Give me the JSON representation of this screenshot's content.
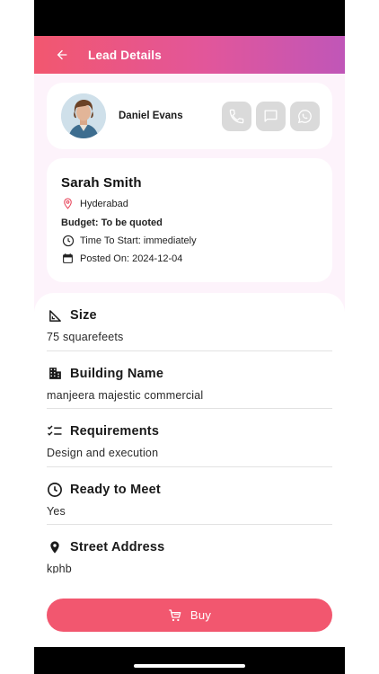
{
  "header": {
    "title": "Lead Details",
    "back_icon": "arrow-left-icon"
  },
  "contact": {
    "name": "Daniel Evans",
    "actions": [
      {
        "name": "call",
        "icon": "phone-icon"
      },
      {
        "name": "message",
        "icon": "chat-icon"
      },
      {
        "name": "whatsapp",
        "icon": "whatsapp-icon"
      }
    ]
  },
  "lead": {
    "name": "Sarah Smith",
    "location": "Hyderabad",
    "budget": "Budget: To be quoted",
    "time_to_start": "Time To Start: immediately",
    "posted_on": "Posted On: 2024-12-04"
  },
  "details": [
    {
      "title": "Size",
      "value": "75 squarefeets",
      "icon": "ruler-icon"
    },
    {
      "title": "Building Name",
      "value": "manjeera majestic commercial",
      "icon": "building-icon"
    },
    {
      "title": "Requirements",
      "value": "Design and execution",
      "icon": "checklist-icon"
    },
    {
      "title": "Ready to Meet",
      "value": "Yes",
      "icon": "clock-icon"
    },
    {
      "title": "Street Address",
      "value": "kphb",
      "icon": "location-pin-icon"
    }
  ],
  "buy_button": {
    "label": "Buy",
    "icon": "cart-icon"
  },
  "colors": {
    "accent": "#f2576f",
    "gradient_end": "#c056b8",
    "background": "#fdf3fb"
  }
}
